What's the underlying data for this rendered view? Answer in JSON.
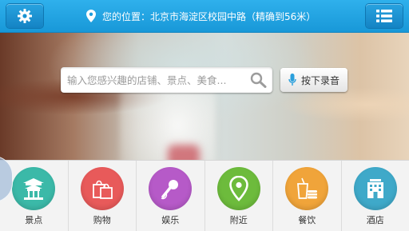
{
  "header": {
    "location_label": "您的位置：",
    "location_value": "北京市海淀区校园中路",
    "accuracy": "（精确到56米）"
  },
  "search": {
    "placeholder": "输入您感兴趣的店铺、景点、美食..."
  },
  "voice_button": {
    "label": "按下录音"
  },
  "categories": [
    {
      "label": "景点",
      "icon": "temple-icon",
      "color": "#3bb9a8"
    },
    {
      "label": "购物",
      "icon": "shopping-bag-icon",
      "color": "#e85a5a"
    },
    {
      "label": "娱乐",
      "icon": "microphone-icon",
      "color": "#b65ac8"
    },
    {
      "label": "附近",
      "icon": "location-pin-icon",
      "color": "#6dbb3c"
    },
    {
      "label": "餐饮",
      "icon": "food-drink-icon",
      "color": "#f0a43a"
    },
    {
      "label": "酒店",
      "icon": "hotel-building-icon",
      "color": "#3fa9c9"
    }
  ],
  "colors": {
    "topbar": "#1fa3e2",
    "panel_bg": "#f3f3f3"
  }
}
